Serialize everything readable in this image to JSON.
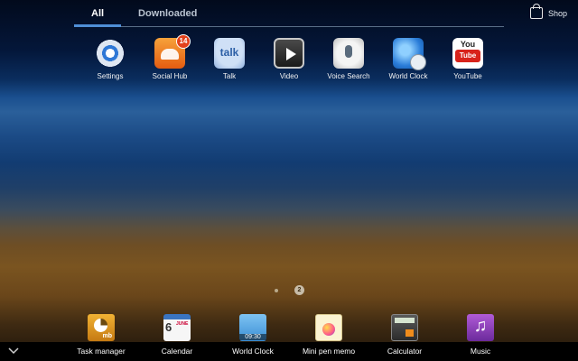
{
  "tabs": [
    {
      "label": "All",
      "selected": true
    },
    {
      "label": "Downloaded",
      "selected": false
    }
  ],
  "shop": {
    "label": "Shop",
    "icon": "shopping-bag-icon"
  },
  "apps": [
    {
      "label": "Settings",
      "icon": "settings-gear-icon"
    },
    {
      "label": "Social Hub",
      "icon": "social-hub-icon",
      "badge": "14"
    },
    {
      "label": "Talk",
      "icon": "talk-bubble-icon",
      "icon_text": "talk"
    },
    {
      "label": "Video",
      "icon": "video-play-icon"
    },
    {
      "label": "Voice Search",
      "icon": "microphone-icon"
    },
    {
      "label": "World Clock",
      "icon": "globe-clock-icon"
    },
    {
      "label": "YouTube",
      "icon": "youtube-icon",
      "icon_text_top": "You",
      "icon_text_bottom": "Tube"
    }
  ],
  "pager": {
    "current_page": "2"
  },
  "dock": [
    {
      "label": "Task manager",
      "icon": "task-manager-icon",
      "icon_text": "mb"
    },
    {
      "label": "Calendar",
      "icon": "calendar-icon",
      "icon_day": "6",
      "icon_month": "JUNE"
    },
    {
      "label": "World Clock",
      "icon": "world-clock-icon",
      "icon_time": "09:30"
    },
    {
      "label": "Mini pen memo",
      "icon": "mini-pen-memo-icon"
    },
    {
      "label": "Calculator",
      "icon": "calculator-icon"
    },
    {
      "label": "Music",
      "icon": "music-note-icon"
    }
  ],
  "colors": {
    "accent": "#4f8fd6",
    "dock_bar": "#000000",
    "badge": "#e3411b"
  }
}
